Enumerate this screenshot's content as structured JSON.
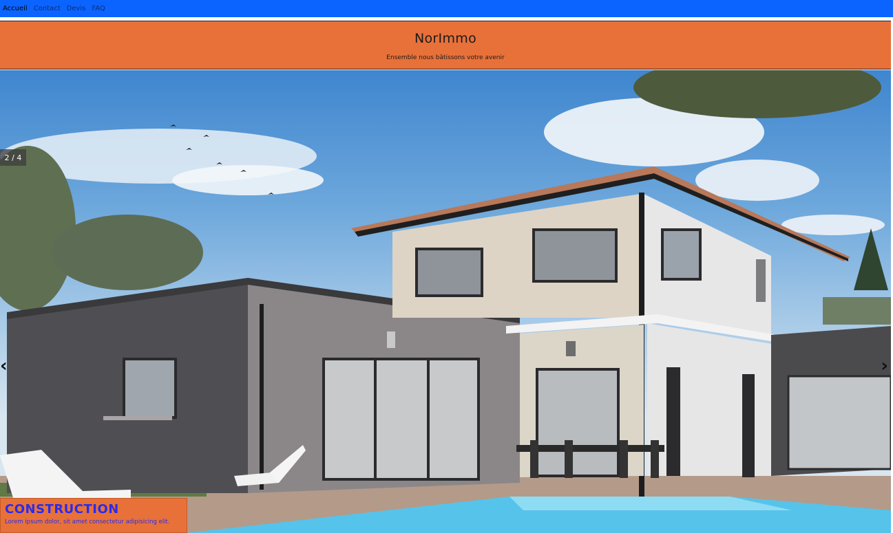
{
  "nav": {
    "items": [
      {
        "label": "Accueil",
        "active": true
      },
      {
        "label": "Contact",
        "active": false
      },
      {
        "label": "Devis",
        "active": false
      },
      {
        "label": "FAQ",
        "active": false
      }
    ]
  },
  "header": {
    "brand": "NorImmo",
    "tagline": "Ensemble nous bâtissons votre avenir"
  },
  "slideshow": {
    "counter": "2 / 4",
    "prev_icon": "‹",
    "next_icon": "›",
    "caption_title": "CONSTRUCTION",
    "caption_text": "Lorem ipsum dolor, sit amet consectetur adipisicing elit."
  },
  "colors": {
    "nav_bg": "#0b64ff",
    "header_bg": "#e8713a",
    "caption_text": "#2a2ce8"
  }
}
